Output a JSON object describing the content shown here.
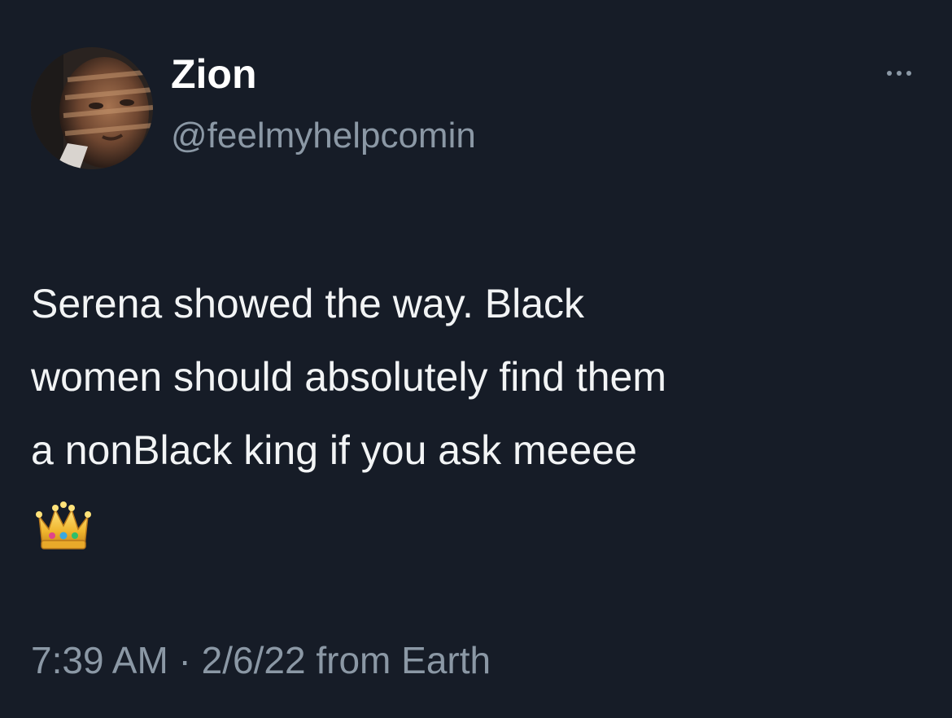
{
  "author": {
    "display_name": "Zion",
    "handle": "@feelmyhelpcomin",
    "avatar_icon": "profile-photo"
  },
  "more_icon": "more-horizontal-icon",
  "tweet": {
    "lines": [
      "Serena showed the way. Black",
      "women should absolutely find them",
      "a nonBlack king if you ask meeee"
    ],
    "emoji": "crown"
  },
  "meta": {
    "time": "7:39 AM",
    "separator": " · ",
    "date": "2/6/22",
    "source": " from Earth"
  },
  "colors": {
    "background": "#161c27",
    "text": "#f2f4f5",
    "secondary": "#8b98a5"
  }
}
